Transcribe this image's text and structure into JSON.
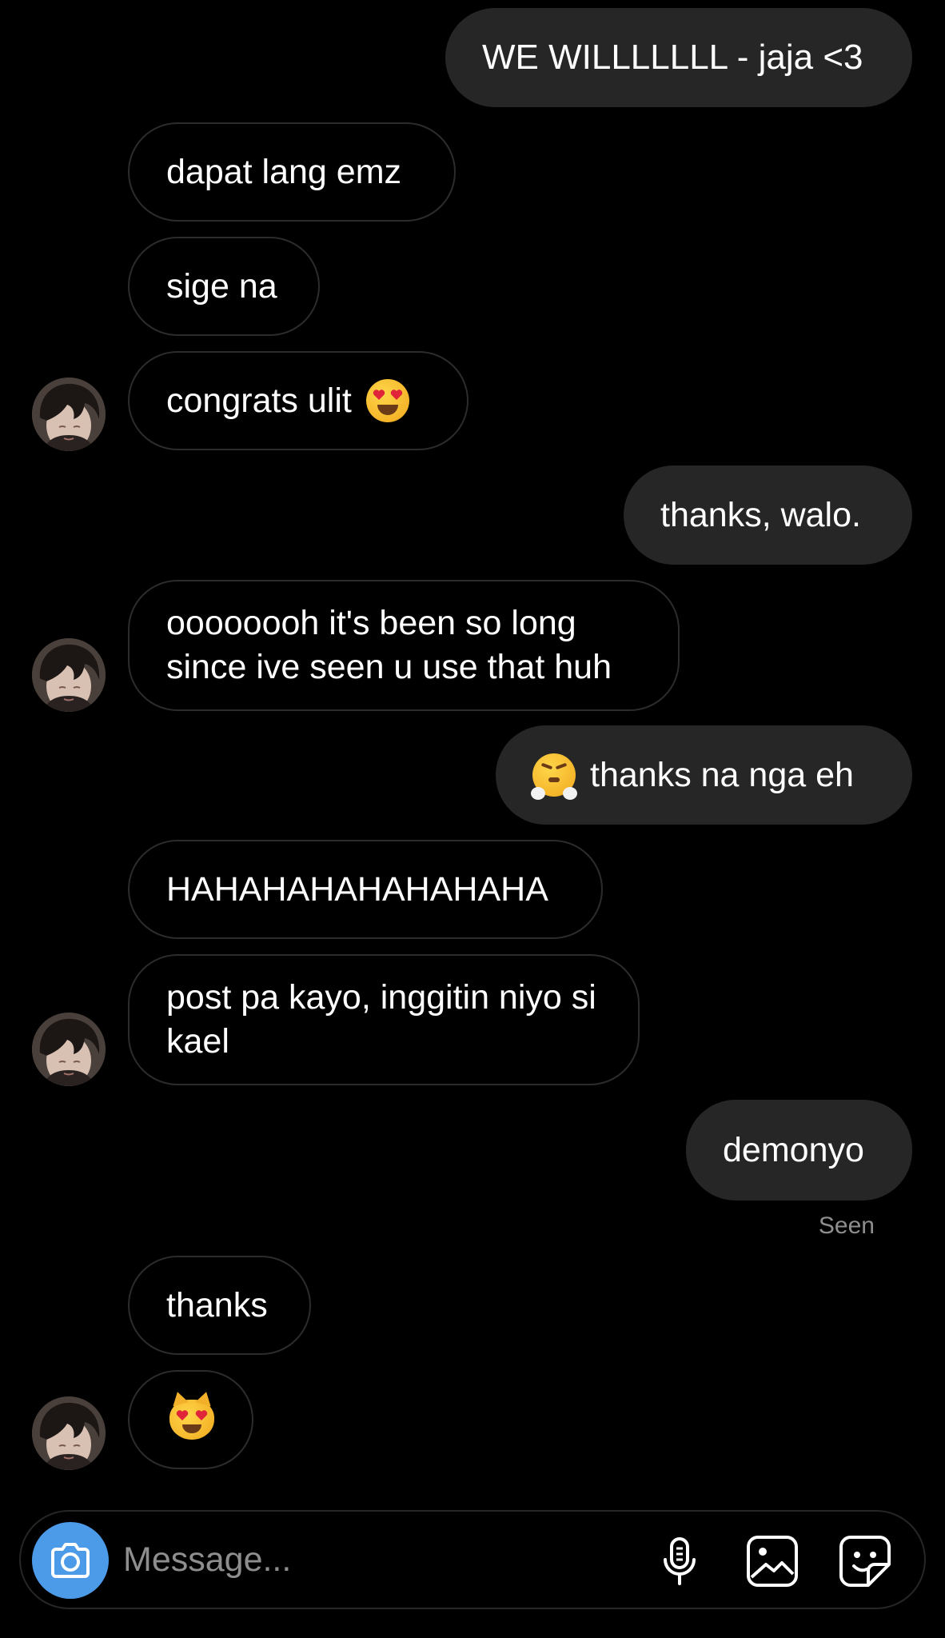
{
  "messages": [
    {
      "side": "sent",
      "text": "WE WILLLLLLL - jaja <3"
    },
    {
      "side": "received",
      "text": "dapat lang emz"
    },
    {
      "side": "received",
      "text": "sige na"
    },
    {
      "side": "received",
      "text": "congrats ulit",
      "emoji": "smiling-face-with-heart-eyes"
    },
    {
      "side": "sent",
      "text": "thanks, walo."
    },
    {
      "side": "received",
      "text": "oooooooh it's been so long since ive seen u use that huh"
    },
    {
      "side": "sent",
      "text": "thanks na nga eh",
      "emoji": "face-with-steam-from-nose"
    },
    {
      "side": "received",
      "text": "HAHAHAHAHAHAHAHA"
    },
    {
      "side": "received",
      "text": "post pa kayo, inggitin niyo si kael"
    },
    {
      "side": "sent",
      "text": "demonyo"
    },
    {
      "side": "received",
      "text": "thanks"
    },
    {
      "side": "received",
      "text": "",
      "emoji": "smiling-cat-with-heart-eyes"
    }
  ],
  "status": {
    "seen": "Seen"
  },
  "composer": {
    "placeholder": "Message...",
    "icons": [
      "camera-icon",
      "microphone-icon",
      "gallery-icon",
      "sticker-icon"
    ]
  },
  "colors": {
    "background": "#000000",
    "sent_bubble": "#262626",
    "received_border": "#2c2c2c",
    "camera_button": "#4c9be9",
    "muted_text": "#8e8e8e"
  }
}
